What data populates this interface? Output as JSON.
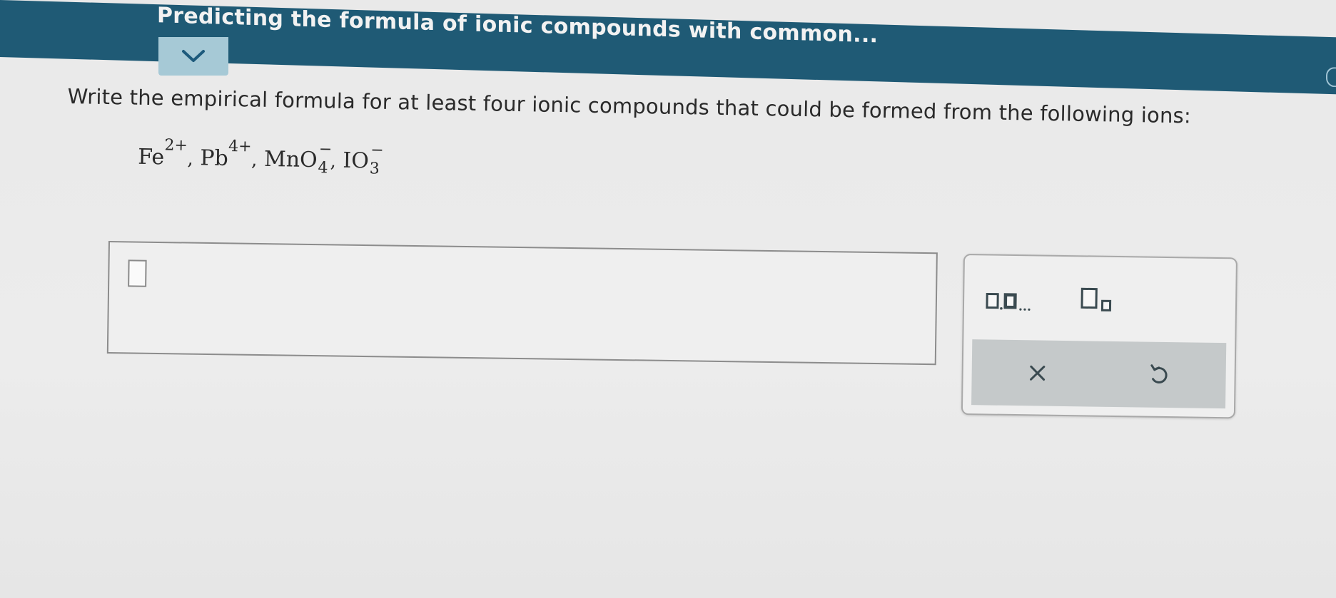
{
  "header": {
    "title": "Predicting the formula of ionic compounds with common..."
  },
  "question": {
    "prompt": "Write the empirical formula for at least four ionic compounds that could be formed from the following ions:",
    "ions": [
      {
        "base": "Fe",
        "charge": "2+"
      },
      {
        "base": "Pb",
        "charge": "4+"
      },
      {
        "base": "MnO",
        "subscript": "4",
        "charge": "−"
      },
      {
        "base": "IO",
        "subscript": "3",
        "charge": "−"
      }
    ],
    "separator": ","
  },
  "answer": {
    "value": ""
  },
  "palette": {
    "buttons": {
      "multi_entry_icon": "list-of-boxes-icon",
      "subscript_icon": "subscript-box-icon",
      "clear_icon": "x-icon",
      "undo_icon": "undo-icon"
    }
  },
  "colors": {
    "header_bg": "#1f5a75",
    "collapse_tab_bg": "#a6c9d6",
    "chevron": "#1d5a7c",
    "action_bar_bg": "#c5c9ca",
    "icon_dark": "#3a4a50"
  }
}
